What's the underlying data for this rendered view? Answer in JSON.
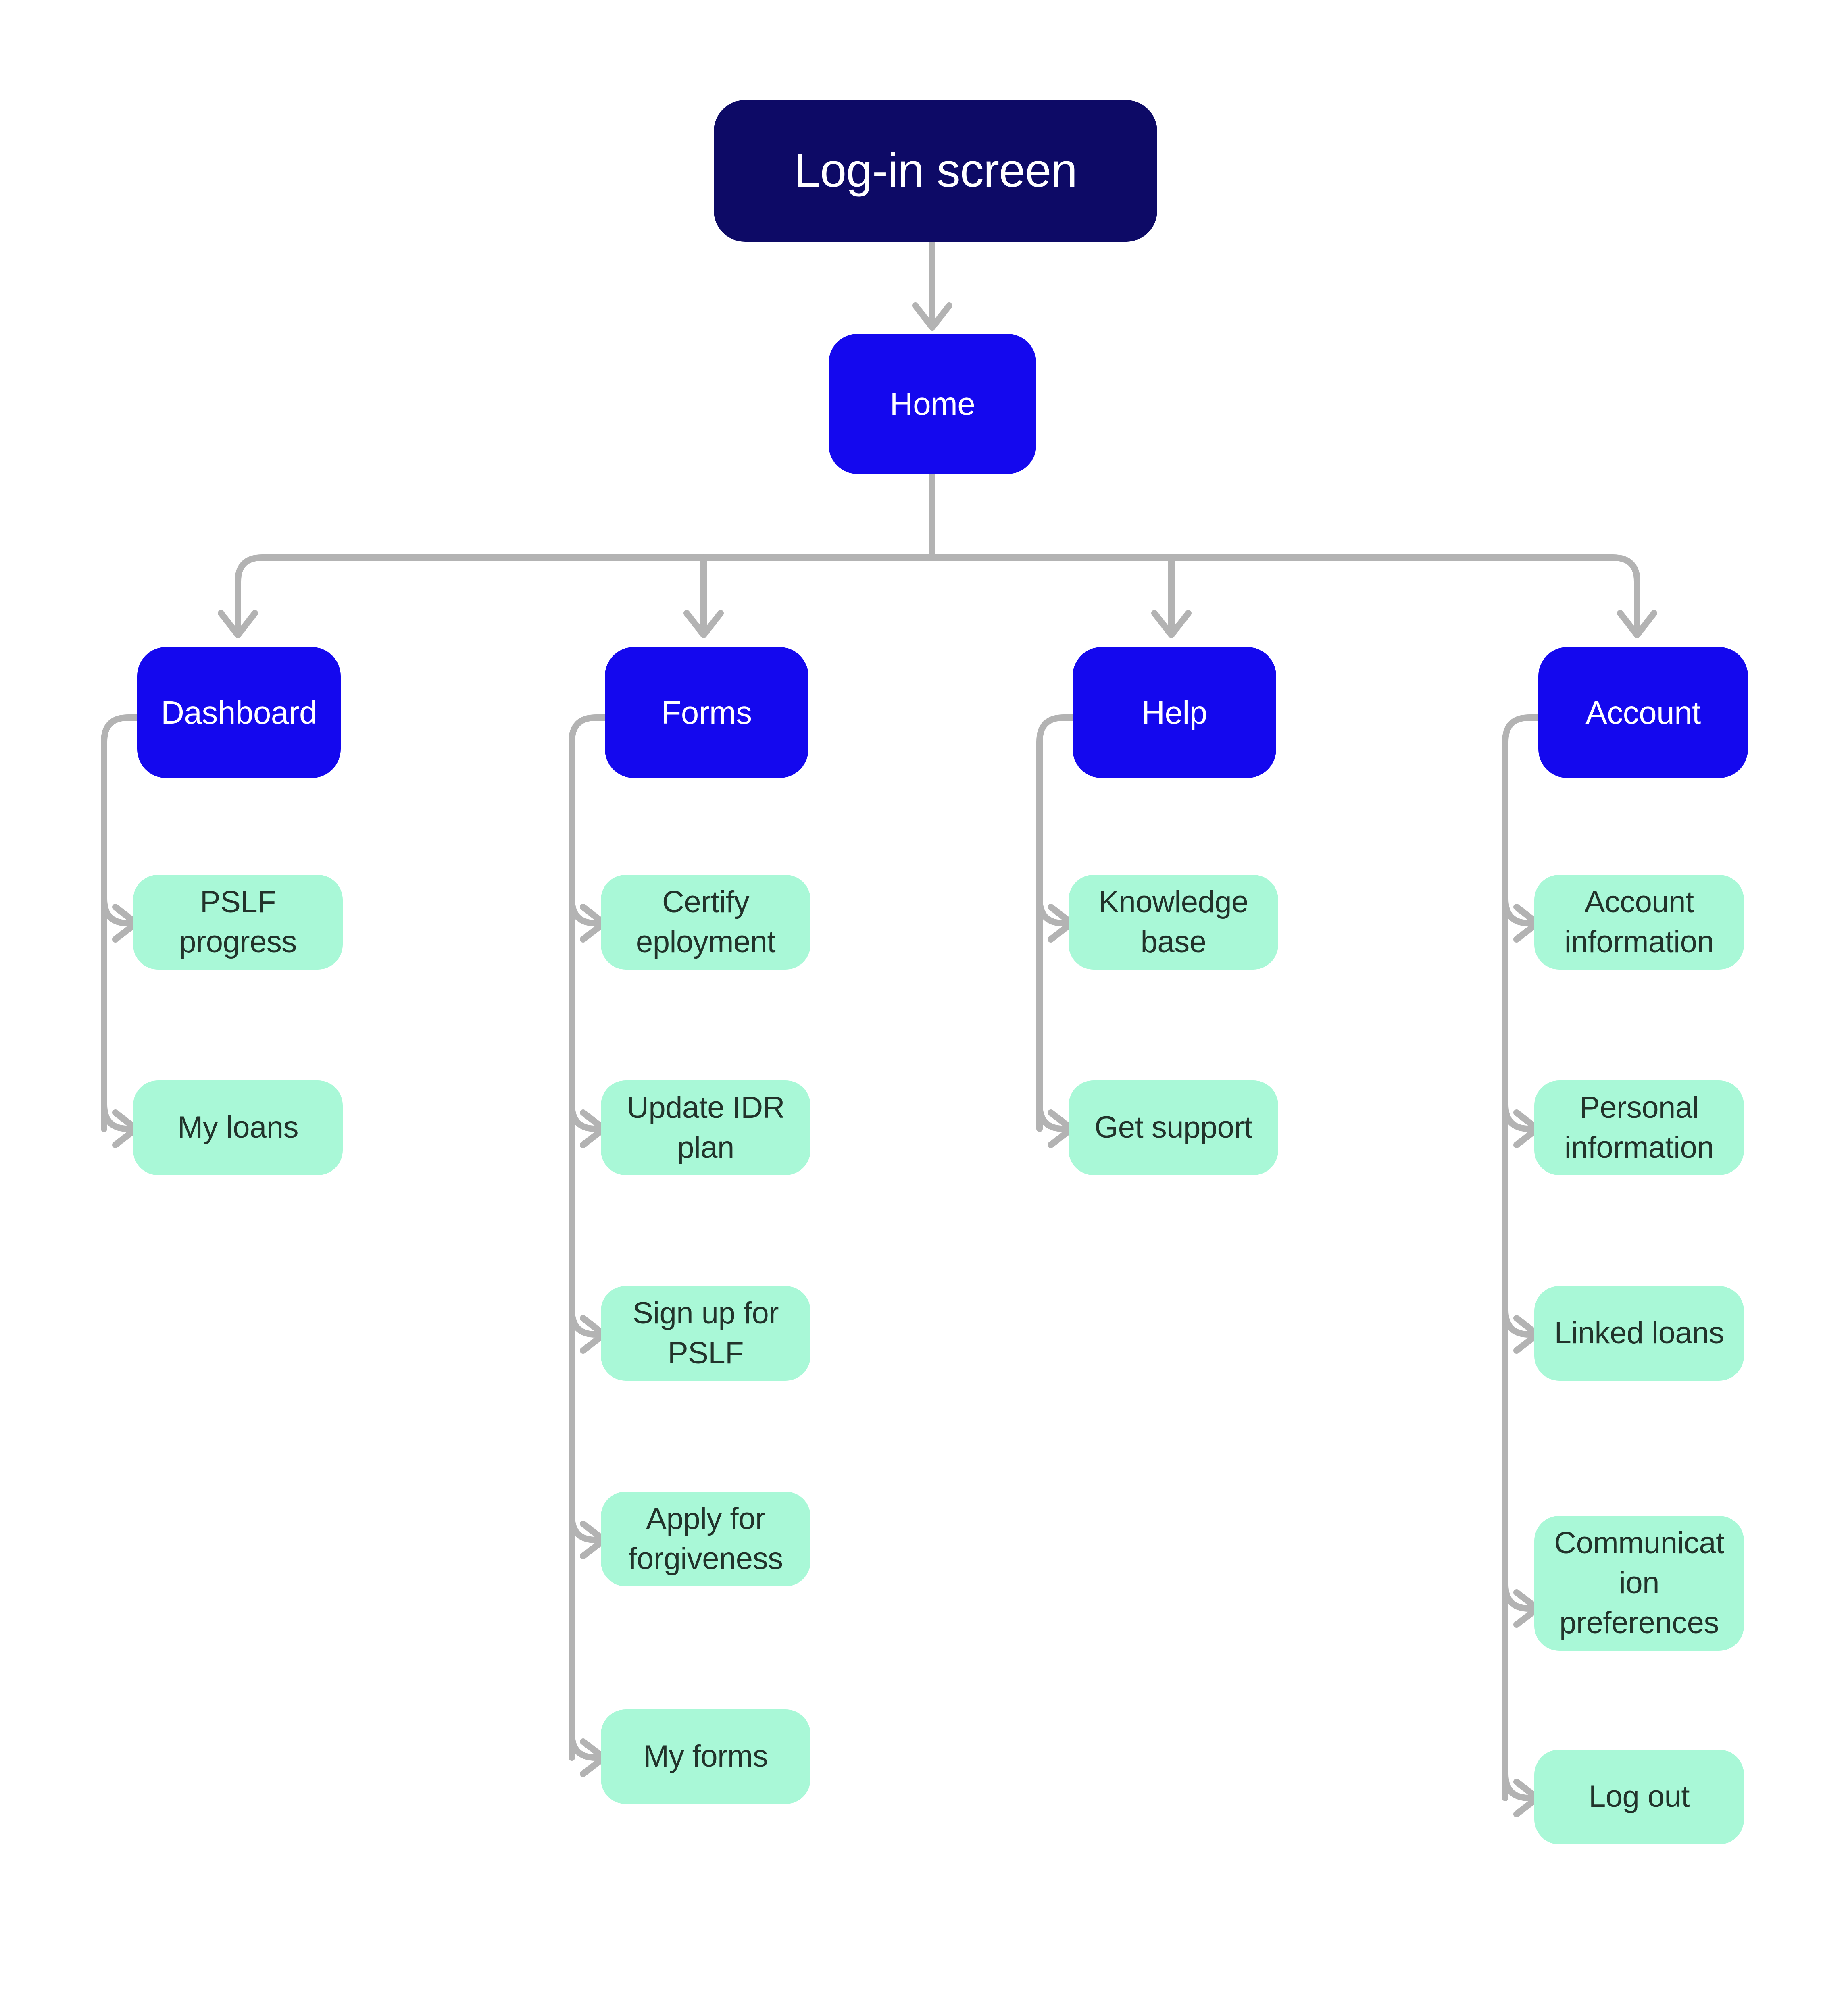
{
  "diagram": {
    "type": "sitemap-flowchart",
    "title_node": "Log-in screen",
    "colors": {
      "root_fill": "#0D0A66",
      "root_text": "#FFFFFF",
      "section_fill": "#1408EE",
      "section_text": "#FFFFFF",
      "leaf_fill": "#A9F8D7",
      "leaf_text": "#22332B",
      "connector": "#B3B3B3",
      "background": "#FFFFFF"
    },
    "root": {
      "label": "Log-in screen"
    },
    "home": {
      "label": "Home"
    },
    "columns": [
      {
        "section": "Dashboard",
        "children": [
          "PSLF\nprogress",
          "My loans"
        ]
      },
      {
        "section": "Forms",
        "children": [
          "Certify\neployment",
          "Update IDR\nplan",
          "Sign up for\nPSLF",
          "Apply for\nforgiveness",
          "My forms"
        ]
      },
      {
        "section": "Help",
        "children": [
          "Knowledge\nbase",
          "Get support"
        ]
      },
      {
        "section": "Account",
        "children": [
          "Account\ninformation",
          "Personal\ninformation",
          "Linked loans",
          "Communicat\nion\npreferences",
          "Log out"
        ]
      }
    ]
  }
}
